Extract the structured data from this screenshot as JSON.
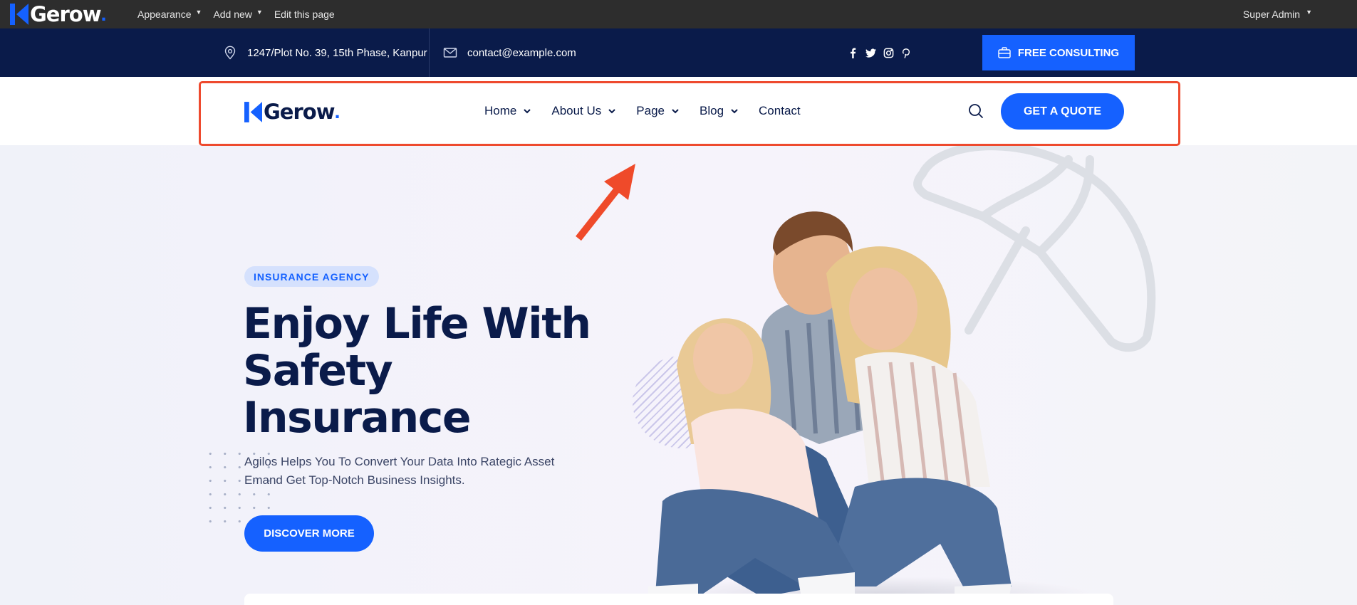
{
  "colors": {
    "brand_blue": "#1561ff",
    "navy": "#0a1b4a",
    "admin_bar": "#2d2d2d",
    "highlight": "#ee4a2e"
  },
  "admin_bar": {
    "logo": "Gerow",
    "menu": [
      {
        "label": "Appearance",
        "has_dropdown": true
      },
      {
        "label": "Add new",
        "has_dropdown": true
      },
      {
        "label": "Edit this page",
        "has_dropdown": false
      }
    ],
    "user": "Super Admin"
  },
  "topbar": {
    "address": "1247/Plot No. 39, 15th Phase, Kanpur",
    "email": "contact@example.com",
    "social": [
      "facebook-icon",
      "twitter-icon",
      "instagram-icon",
      "pinterest-icon"
    ],
    "cta": "FREE CONSULTING"
  },
  "nav": {
    "logo": "Gerow",
    "links": [
      {
        "label": "Home",
        "has_dropdown": true
      },
      {
        "label": "About Us",
        "has_dropdown": true
      },
      {
        "label": "Page",
        "has_dropdown": true
      },
      {
        "label": "Blog",
        "has_dropdown": true
      },
      {
        "label": "Contact",
        "has_dropdown": false
      }
    ],
    "cta": "GET A QUOTE"
  },
  "hero": {
    "badge": "INSURANCE AGENCY",
    "title_lines": [
      "Enjoy Life With",
      "Safety",
      "Insurance"
    ],
    "lead": "Agilos Helps You To Convert Your Data Into Rategic Asset Emand Get Top-Notch Business Insights.",
    "button": "DISCOVER MORE"
  }
}
